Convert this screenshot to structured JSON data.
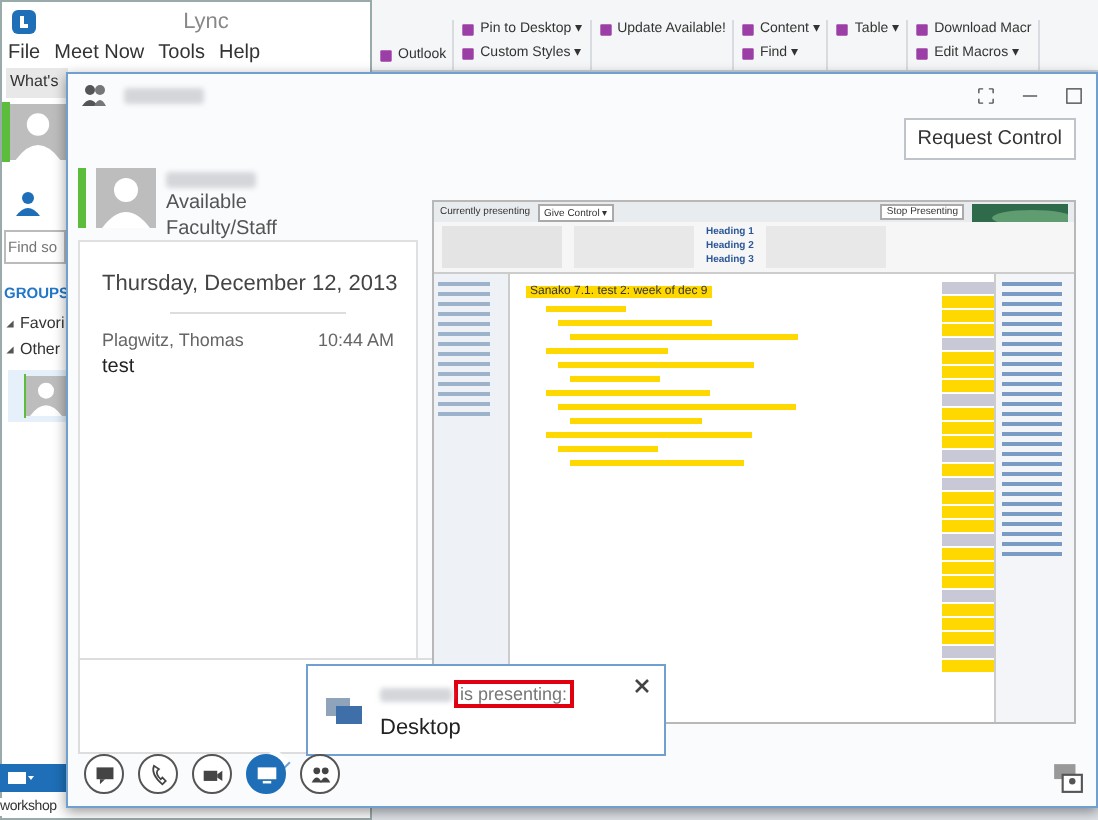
{
  "background_ribbon": {
    "groups": [
      {
        "items": [
          {
            "label": "Outlook"
          }
        ]
      },
      {
        "items": [
          {
            "label": "Pin to Desktop ▾"
          },
          {
            "label": "Custom Styles ▾"
          }
        ]
      },
      {
        "items": [
          {
            "label": "Update Available!"
          }
        ]
      },
      {
        "items": [
          {
            "label": "Content ▾"
          },
          {
            "label": "Find ▾"
          }
        ]
      },
      {
        "items": [
          {
            "label": "Table ▾"
          }
        ]
      },
      {
        "items": [
          {
            "label": "Download Macr"
          },
          {
            "label": "Edit Macros ▾"
          }
        ]
      }
    ]
  },
  "lync_window": {
    "title": "Lync",
    "menu": [
      "File",
      "Meet Now",
      "Tools",
      "Help"
    ],
    "tab": "What's",
    "search": {
      "placeholder": "Find so"
    },
    "groups_heading": "GROUPS",
    "groups": [
      {
        "label": "Favori",
        "expanded": true
      },
      {
        "label": "Other",
        "expanded": true
      }
    ],
    "status_label": "workshop"
  },
  "conversation": {
    "request_control": "Request Control",
    "contact": {
      "status": "Available",
      "role": "Faculty/Staff"
    },
    "chat": {
      "date": "Thursday, December 12, 2013",
      "messages": [
        {
          "sender": "Plagwitz, Thomas",
          "time": "10:44 AM",
          "text": "test"
        }
      ]
    },
    "shared_screen": {
      "presenting_label": "Currently presenting",
      "give_control": "Give Control ▾",
      "stop": "Stop Presenting",
      "headings": [
        "Heading 1",
        "Heading 2",
        "Heading 3"
      ],
      "page_title": "Sanako 7.1. test 2: week of dec  9"
    },
    "popup": {
      "message": "is presenting:",
      "target": "Desktop"
    },
    "modes": [
      {
        "kind": "im",
        "selected": false
      },
      {
        "kind": "call",
        "selected": false
      },
      {
        "kind": "video",
        "selected": false
      },
      {
        "kind": "share",
        "selected": true
      },
      {
        "kind": "people",
        "selected": false
      }
    ]
  }
}
